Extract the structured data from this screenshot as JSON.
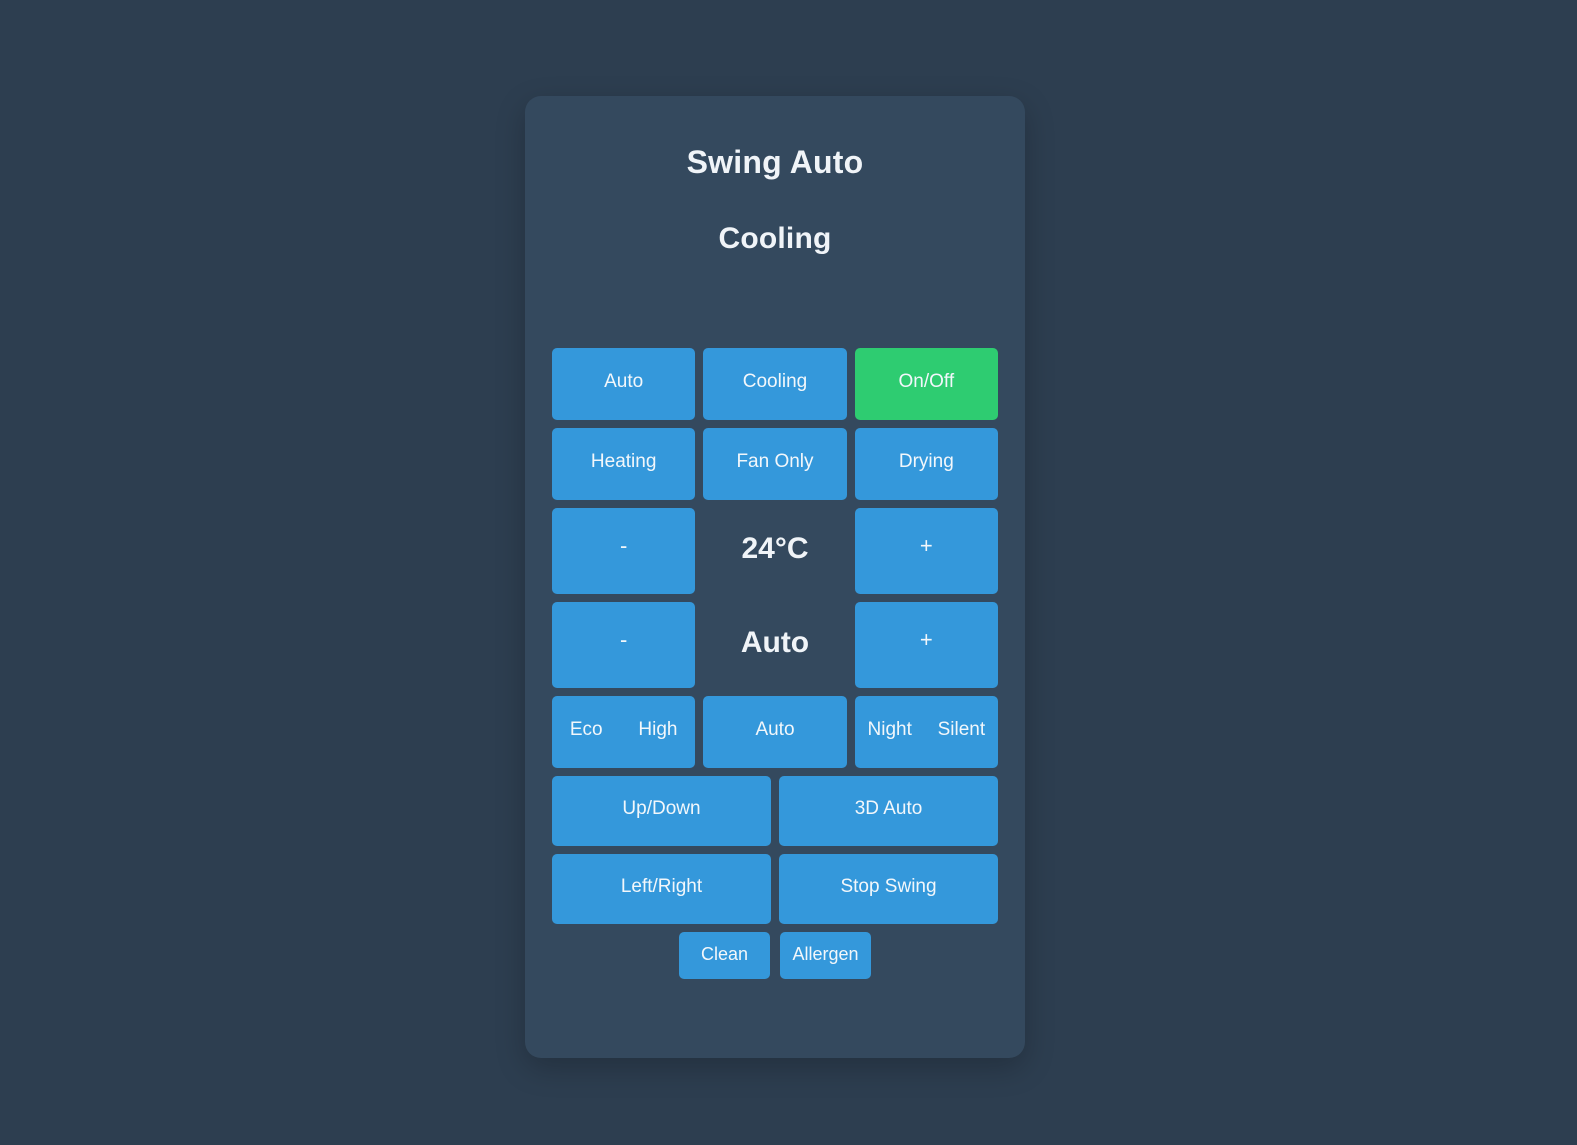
{
  "header": {
    "title": "Swing Auto",
    "subtitle": "Cooling"
  },
  "colors": {
    "page_background": "#2d3e50",
    "card_background": "#34495e",
    "button": "#3498db",
    "button_active": "#2ecc71",
    "text": "#f0f4f8"
  },
  "modes": {
    "row1": [
      {
        "label": "Auto",
        "state": "inactive"
      },
      {
        "label": "Cooling",
        "state": "inactive"
      },
      {
        "label": "On/Off",
        "state": "active"
      }
    ],
    "row2": [
      {
        "label": "Heating",
        "state": "inactive"
      },
      {
        "label": "Fan Only",
        "state": "inactive"
      },
      {
        "label": "Drying",
        "state": "inactive"
      }
    ]
  },
  "temperature": {
    "decrease_label": "-",
    "value": "24°C",
    "increase_label": "+"
  },
  "fan_speed": {
    "decrease_label": "-",
    "value": "Auto",
    "increase_label": "+"
  },
  "presets": {
    "left_pair": [
      "Eco",
      "High"
    ],
    "center": "Auto",
    "right_pair": [
      "Night",
      "Silent"
    ]
  },
  "swing": {
    "row1": [
      "Up/Down",
      "3D Auto"
    ],
    "row2": [
      "Left/Right",
      "Stop Swing"
    ]
  },
  "extras": [
    "Clean",
    "Allergen"
  ]
}
